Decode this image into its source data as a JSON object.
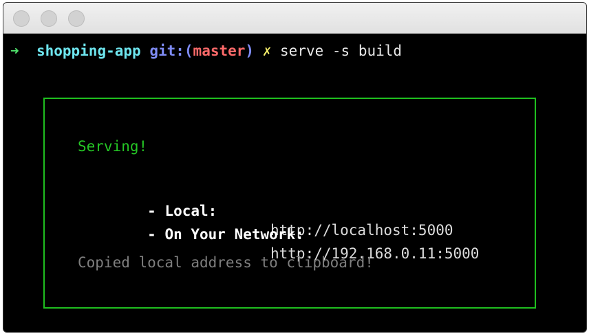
{
  "window": {
    "traffic_lights": [
      "close",
      "minimize",
      "zoom"
    ]
  },
  "prompt": {
    "arrow": "➜",
    "directory": "shopping-app",
    "git_prefix": "git:(",
    "branch": "master",
    "git_suffix": ")",
    "dirty_marker": "✗",
    "command": "serve -s build"
  },
  "output": {
    "status": "Serving!",
    "local_label": "- Local:",
    "local_url": "http://localhost:5000",
    "network_label": "- On Your Network:",
    "network_url": "http://192.168.0.11:5000",
    "clipboard_message": "Copied local address to clipboard!"
  },
  "colors": {
    "box_border": "#1fbf1f",
    "status": "#25c625",
    "directory": "#6ee6ef",
    "branch": "#ff6a6a",
    "git": "#7f8cf5",
    "dirty": "#f5ef6b"
  }
}
